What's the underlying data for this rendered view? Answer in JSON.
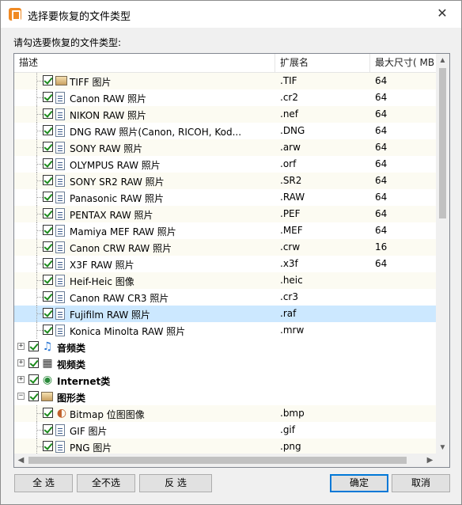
{
  "window": {
    "title": "选择要恢复的文件类型",
    "close_glyph": "✕"
  },
  "instruction": "请勾选要恢复的文件类型:",
  "columns": {
    "name": "描述",
    "ext": "扩展名",
    "size": "最大尺寸( MB"
  },
  "rows": [
    {
      "kind": "item",
      "icon": "image-icon",
      "name": "TIFF 图片",
      "ext": ".TIF",
      "size": "64"
    },
    {
      "kind": "item",
      "icon": "file-icon",
      "name": "Canon RAW 照片",
      "ext": ".cr2",
      "size": "64"
    },
    {
      "kind": "item",
      "icon": "file-icon",
      "name": "NIKON RAW 照片",
      "ext": ".nef",
      "size": "64"
    },
    {
      "kind": "item",
      "icon": "file-icon",
      "name": "DNG RAW 照片(Canon, RICOH, Kod...",
      "ext": ".DNG",
      "size": "64"
    },
    {
      "kind": "item",
      "icon": "file-icon",
      "name": "SONY RAW 照片",
      "ext": ".arw",
      "size": "64"
    },
    {
      "kind": "item",
      "icon": "file-icon",
      "name": "OLYMPUS RAW 照片",
      "ext": ".orf",
      "size": "64"
    },
    {
      "kind": "item",
      "icon": "file-icon",
      "name": "SONY SR2 RAW 照片",
      "ext": ".SR2",
      "size": "64"
    },
    {
      "kind": "item",
      "icon": "file-icon",
      "name": "Panasonic RAW 照片",
      "ext": ".RAW",
      "size": "64"
    },
    {
      "kind": "item",
      "icon": "file-icon",
      "name": "PENTAX RAW 照片",
      "ext": ".PEF",
      "size": "64"
    },
    {
      "kind": "item",
      "icon": "file-icon",
      "name": "Mamiya MEF RAW 照片",
      "ext": ".MEF",
      "size": "64"
    },
    {
      "kind": "item",
      "icon": "file-icon",
      "name": "Canon CRW RAW 照片",
      "ext": ".crw",
      "size": "16"
    },
    {
      "kind": "item",
      "icon": "file-icon",
      "name": "X3F RAW 照片",
      "ext": ".x3f",
      "size": "64"
    },
    {
      "kind": "item",
      "icon": "file-icon",
      "name": "Heif-Heic 图像",
      "ext": ".heic",
      "size": ""
    },
    {
      "kind": "item",
      "icon": "file-icon",
      "name": "Canon RAW CR3 照片",
      "ext": ".cr3",
      "size": ""
    },
    {
      "kind": "item",
      "icon": "file-icon",
      "name": "Fujifilm RAW 照片",
      "ext": ".raf",
      "size": "",
      "selected": true
    },
    {
      "kind": "item",
      "icon": "file-icon",
      "name": "Konica Minolta RAW 照片",
      "ext": ".mrw",
      "size": ""
    },
    {
      "kind": "group",
      "expander": "+",
      "icon": "music-icon",
      "name": "音频类"
    },
    {
      "kind": "group",
      "expander": "+",
      "icon": "film-icon",
      "name": "视频类"
    },
    {
      "kind": "group",
      "expander": "+",
      "icon": "globe-icon",
      "name": "Internet类"
    },
    {
      "kind": "group",
      "expander": "−",
      "icon": "image-folder-icon",
      "name": "图形类"
    },
    {
      "kind": "item",
      "icon": "paint-icon",
      "name": "Bitmap 位图图像",
      "ext": ".bmp",
      "size": ""
    },
    {
      "kind": "item",
      "icon": "file-icon",
      "name": "GIF 图片",
      "ext": ".gif",
      "size": ""
    },
    {
      "kind": "item",
      "icon": "file-icon",
      "name": "PNG 图片",
      "ext": ".png",
      "size": ""
    }
  ],
  "buttons": {
    "select_all": "全 选",
    "select_none": "全不选",
    "invert": "反 选",
    "ok": "确定",
    "cancel": "取消"
  },
  "scroll": {
    "up": "▲",
    "down": "▼",
    "left": "◀",
    "right": "▶"
  },
  "glyphs": {
    "music": "♫",
    "film": "▦",
    "globe": "◉",
    "paint": "◐"
  },
  "colors": {
    "selected_row": "#cce8ff",
    "checkmark": "#1b8a1b",
    "primary_border": "#0078d7"
  }
}
